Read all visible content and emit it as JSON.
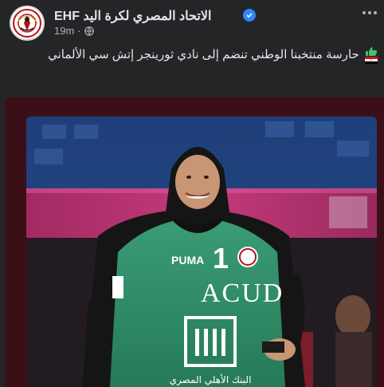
{
  "post": {
    "page_name": "الاتحاد  المصري  لكرة  اليد EHF",
    "time": "19m",
    "separator": "·",
    "audience_icon": "globe-icon",
    "caption": "حارسة منتخبنا الوطني تنضم إلى نادي ثورينجر إتش سي الألماني"
  },
  "photo": {
    "jersey_number": "1",
    "sponsor": "ACUD",
    "bank": "البنك الأهلي المصري",
    "brand": "PUMA"
  },
  "colors": {
    "background": "#242526",
    "text_primary": "#e4e6eb",
    "text_secondary": "#b0b3b8",
    "verified": "#2d88ff",
    "card_frame": "#3b0f17",
    "jersey": "#2e8a66"
  },
  "icons": [
    "logo-icon",
    "verified-icon",
    "globe-icon",
    "more-icon",
    "thumbs-up-icon",
    "egypt-flag-icon"
  ]
}
